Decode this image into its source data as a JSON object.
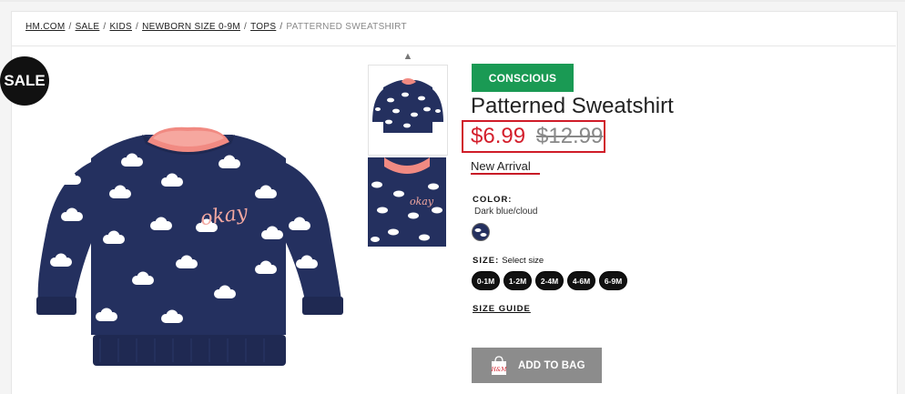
{
  "breadcrumb": {
    "items": [
      "HM.COM",
      "SALE",
      "KIDS",
      "NEWBORN SIZE 0-9M",
      "TOPS"
    ],
    "separator": "/",
    "current": "PATTERNED SWEATSHIRT"
  },
  "sale_badge": "SALE",
  "product": {
    "badge": "CONSCIOUS",
    "badge_color": "#1a9a54",
    "title": "Patterned Sweatshirt",
    "price_now": "$6.99",
    "price_old": "$12.99",
    "label": "New Arrival",
    "color_label": "COLOR:",
    "color_value": "Dark blue/cloud",
    "size_label": "SIZE:",
    "size_placeholder": "Select size",
    "sizes": [
      "0-1M",
      "1-2M",
      "2-4M",
      "4-6M",
      "6-9M"
    ],
    "size_guide": "SIZE GUIDE",
    "add_to_bag": "ADD TO BAG",
    "bag_icon_text": "H&M"
  },
  "colors": {
    "accent_red": "#d01c28",
    "navy": "#24305f"
  }
}
